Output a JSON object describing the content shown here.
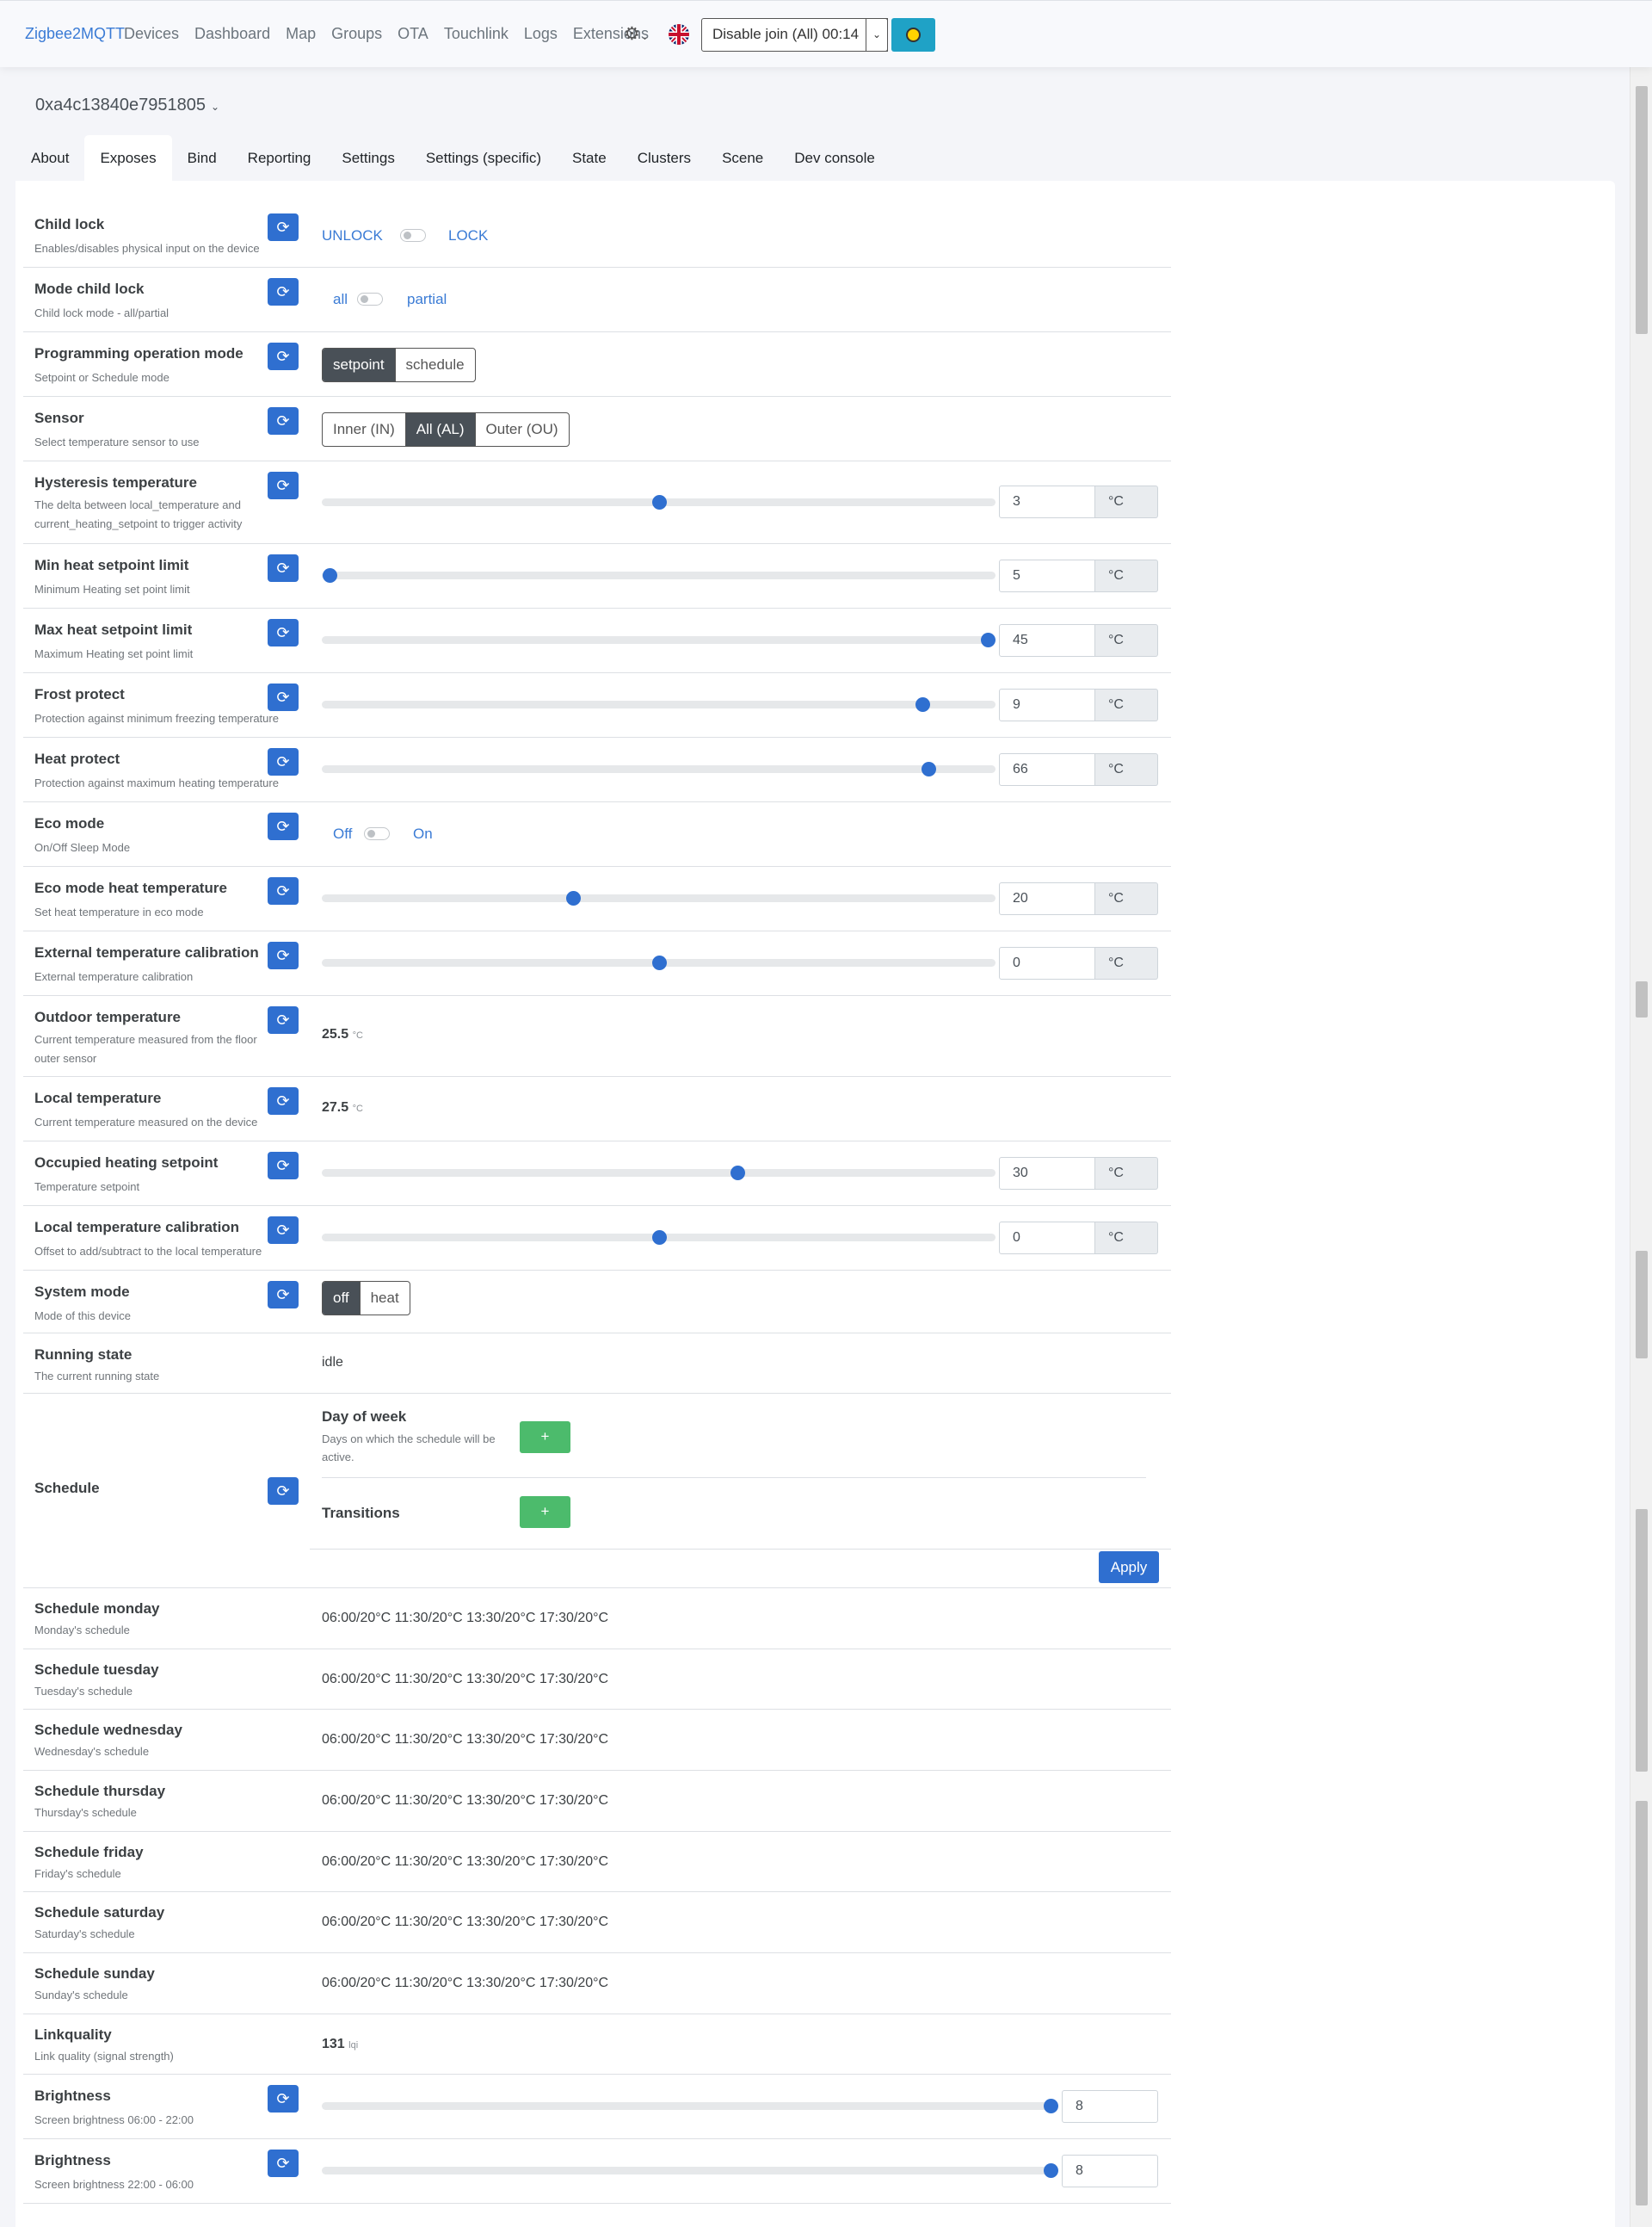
{
  "nav": {
    "brand": "Zigbee2MQTT",
    "links": [
      "Devices",
      "Dashboard",
      "Map",
      "Groups",
      "OTA",
      "Touchlink",
      "Logs",
      "Extensions"
    ],
    "join_button": "Disable join (All) 00:14"
  },
  "device": {
    "name": "0xa4c13840e7951805"
  },
  "tabs": [
    "About",
    "Exposes",
    "Bind",
    "Reporting",
    "Settings",
    "Settings (specific)",
    "State",
    "Clusters",
    "Scene",
    "Dev console"
  ],
  "exposes": {
    "child_lock": {
      "label": "Child lock",
      "desc": "Enables/disables physical input on the device",
      "off": "UNLOCK",
      "on": "LOCK",
      "state": false
    },
    "mode_child_lock": {
      "label": "Mode child lock",
      "desc": "Child lock mode - all/partial",
      "off": "all",
      "on": "partial",
      "state": false
    },
    "programming_mode": {
      "label": "Programming operation mode",
      "desc": "Setpoint or Schedule mode",
      "options": [
        "setpoint",
        "schedule"
      ],
      "selected": "setpoint"
    },
    "sensor": {
      "label": "Sensor",
      "desc": "Select temperature sensor to use",
      "options": [
        "Inner (IN)",
        "All (AL)",
        "Outer (OU)"
      ],
      "selected": "All (AL)"
    },
    "hysteresis": {
      "label": "Hysteresis temperature",
      "desc1": "The delta between local_temperature and",
      "desc2": "current_heating_setpoint to trigger activity",
      "value": "3",
      "unit": "°C",
      "pos": 0.5
    },
    "min_heat": {
      "label": "Min heat setpoint limit",
      "desc": "Minimum Heating set point limit",
      "value": "5",
      "unit": "°C",
      "pos": 0.0
    },
    "max_heat": {
      "label": "Max heat setpoint limit",
      "desc": "Maximum Heating set point limit",
      "value": "45",
      "unit": "°C",
      "pos": 1.0
    },
    "frost": {
      "label": "Frost protect",
      "desc": "Protection against minimum freezing temperature",
      "value": "9",
      "unit": "°C",
      "pos": 0.9
    },
    "heat_protect": {
      "label": "Heat protect",
      "desc": "Protection against maximum heating temperature",
      "value": "66",
      "unit": "°C",
      "pos": 0.91
    },
    "eco_mode": {
      "label": "Eco mode",
      "desc": "On/Off Sleep Mode",
      "off": "Off",
      "on": "On",
      "state": false
    },
    "eco_temp": {
      "label": "Eco mode heat temperature",
      "desc": "Set heat temperature in eco mode",
      "value": "20",
      "unit": "°C",
      "pos": 0.37
    },
    "ext_cal": {
      "label": "External temperature calibration",
      "desc": "External temperature calibration",
      "value": "0",
      "unit": "°C",
      "pos": 0.5
    },
    "outdoor": {
      "label": "Outdoor temperature",
      "desc1": "Current temperature measured from the floor",
      "desc2": "outer sensor",
      "value": "25.5",
      "unit": "°C"
    },
    "local_temp": {
      "label": "Local temperature",
      "desc": "Current temperature measured on the device",
      "value": "27.5",
      "unit": "°C"
    },
    "occupied": {
      "label": "Occupied heating setpoint",
      "desc": "Temperature setpoint",
      "value": "30",
      "unit": "°C",
      "pos": 0.62
    },
    "local_cal": {
      "label": "Local temperature calibration",
      "desc": "Offset to add/subtract to the local temperature",
      "value": "0",
      "unit": "°C",
      "pos": 0.5
    },
    "system_mode": {
      "label": "System mode",
      "desc": "Mode of this device",
      "options": [
        "off",
        "heat"
      ],
      "selected": "off"
    },
    "running_state": {
      "label": "Running state",
      "desc": "The current running state",
      "value": "idle"
    },
    "schedule": {
      "label": "Schedule",
      "dow_label": "Day of week",
      "dow_desc1": "Days on which the schedule will be",
      "dow_desc2": "active.",
      "transitions_label": "Transitions",
      "plus": "+",
      "apply": "Apply"
    },
    "days": [
      {
        "label": "Schedule monday",
        "desc": "Monday's schedule",
        "value": "06:00/20°C 11:30/20°C 13:30/20°C 17:30/20°C"
      },
      {
        "label": "Schedule tuesday",
        "desc": "Tuesday's schedule",
        "value": "06:00/20°C 11:30/20°C 13:30/20°C 17:30/20°C"
      },
      {
        "label": "Schedule wednesday",
        "desc": "Wednesday's schedule",
        "value": "06:00/20°C 11:30/20°C 13:30/20°C 17:30/20°C"
      },
      {
        "label": "Schedule thursday",
        "desc": "Thursday's schedule",
        "value": "06:00/20°C 11:30/20°C 13:30/20°C 17:30/20°C"
      },
      {
        "label": "Schedule friday",
        "desc": "Friday's schedule",
        "value": "06:00/20°C 11:30/20°C 13:30/20°C 17:30/20°C"
      },
      {
        "label": "Schedule saturday",
        "desc": "Saturday's schedule",
        "value": "06:00/20°C 11:30/20°C 13:30/20°C 17:30/20°C"
      },
      {
        "label": "Schedule sunday",
        "desc": "Sunday's schedule",
        "value": "06:00/20°C 11:30/20°C 13:30/20°C 17:30/20°C"
      }
    ],
    "linkquality": {
      "label": "Linkquality",
      "desc": "Link quality (signal strength)",
      "value": "131",
      "unit": "lqi"
    },
    "brightness_day": {
      "label": "Brightness",
      "desc": "Screen brightness 06:00 - 22:00",
      "value": "8",
      "pos": 1.0
    },
    "brightness_night": {
      "label": "Brightness",
      "desc": "Screen brightness 22:00 - 06:00",
      "value": "8",
      "pos": 1.0
    }
  },
  "colors": {
    "accent": "#2f6fd0",
    "link": "#3a7bd5",
    "success": "#4cbb6c",
    "theme_button": "#1fa2c6"
  }
}
